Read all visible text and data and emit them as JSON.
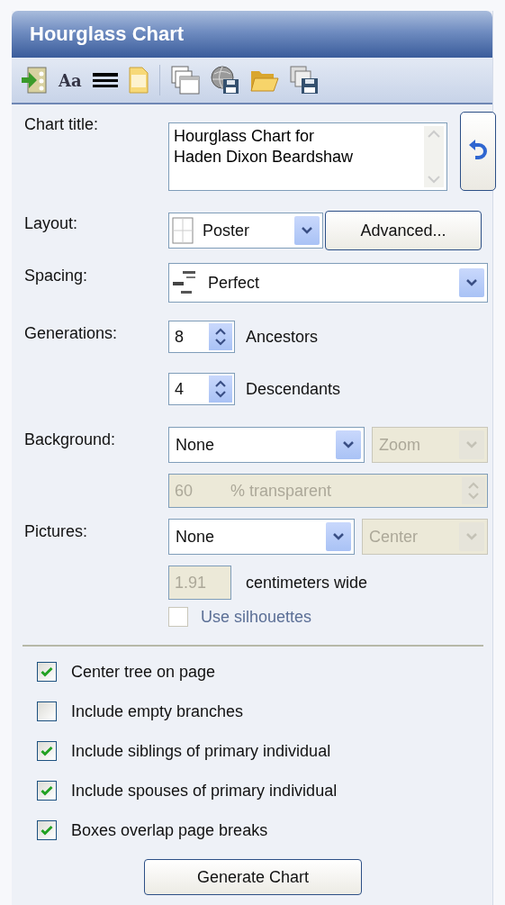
{
  "panel": {
    "title": "Hourglass Chart"
  },
  "toolbar": [
    {
      "kind": "import"
    },
    {
      "kind": "font",
      "label": "Aa"
    },
    {
      "kind": "lines"
    },
    {
      "kind": "page"
    },
    {
      "kind": "separator"
    },
    {
      "kind": "copy"
    },
    {
      "kind": "globe-save"
    },
    {
      "kind": "open"
    },
    {
      "kind": "copy-save"
    }
  ],
  "chart_title": {
    "label": "Chart title:",
    "value": "Hourglass Chart for\nHaden Dixon Beardshaw"
  },
  "layout": {
    "label": "Layout:",
    "value": "Poster",
    "button": "Advanced..."
  },
  "spacing": {
    "label": "Spacing:",
    "value": "Perfect"
  },
  "generations": {
    "label": "Generations:",
    "ancestors": {
      "value": "8",
      "label": "Ancestors"
    },
    "descendants": {
      "value": "4",
      "label": "Descendants"
    }
  },
  "background": {
    "label": "Background:",
    "value": "None",
    "mode": {
      "value": "Zoom",
      "disabled": true
    },
    "transparency": {
      "value": "60",
      "unit": "% transparent",
      "disabled": true
    }
  },
  "pictures": {
    "label": "Pictures:",
    "value": "None",
    "position": {
      "value": "Center",
      "disabled": true
    },
    "width": {
      "value": "1.91",
      "disabled": true
    },
    "width_unit": "centimeters wide",
    "silhouettes": {
      "label": "Use silhouettes",
      "checked": false,
      "disabled": true
    }
  },
  "options": [
    {
      "label": "Center tree on page",
      "checked": true
    },
    {
      "label": "Include empty branches",
      "checked": false
    },
    {
      "label": "Include siblings of primary individual",
      "checked": true
    },
    {
      "label": "Include spouses of primary individual",
      "checked": true
    },
    {
      "label": "Boxes overlap page breaks",
      "checked": true
    }
  ],
  "generate_button": "Generate Chart"
}
